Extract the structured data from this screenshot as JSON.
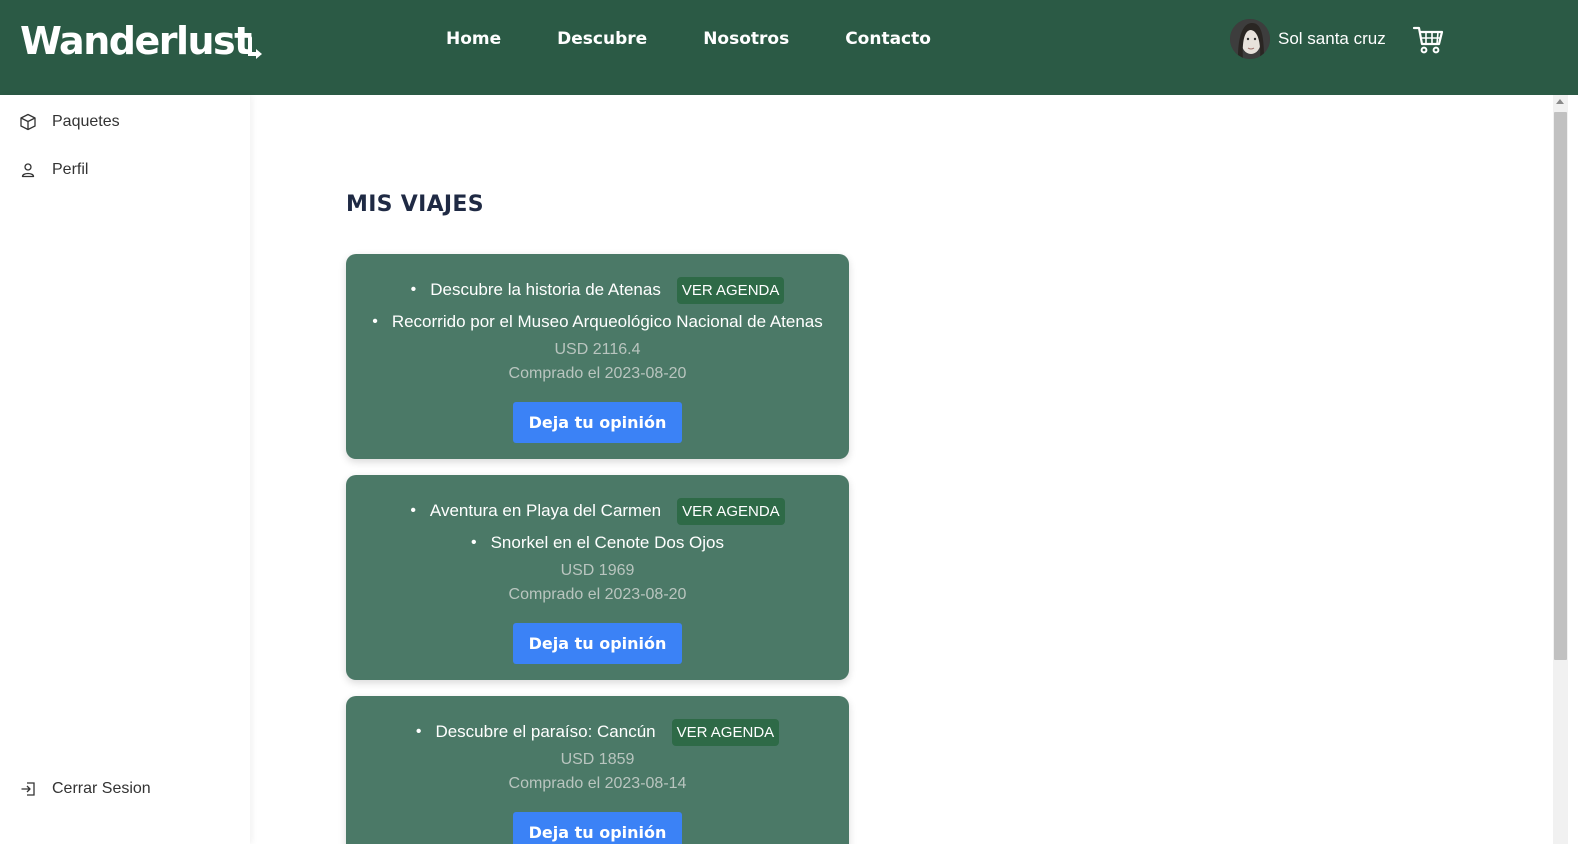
{
  "header": {
    "logo": "Wanderlust",
    "nav": [
      "Home",
      "Descubre",
      "Nosotros",
      "Contacto"
    ],
    "user_name": "Sol santa cruz",
    "avatar_icon": "user-avatar",
    "cart_icon": "shopping-cart-icon"
  },
  "sidebar": {
    "items": [
      {
        "label": "Paquetes",
        "icon": "package-box-icon"
      },
      {
        "label": "Perfil",
        "icon": "user-icon"
      }
    ],
    "logout": {
      "label": "Cerrar Sesion",
      "icon": "logout-icon"
    }
  },
  "main": {
    "title": "MIS VIAJES",
    "trips": [
      {
        "items": [
          "Descubre la historia de Atenas",
          "Recorrido por el Museo Arqueológico Nacional de Atenas"
        ],
        "agenda_label": "VER AGENDA",
        "price": "USD 2116.4",
        "purchased": "Comprado el 2023-08-20",
        "button": "Deja tu opinión"
      },
      {
        "items": [
          "Aventura en Playa del Carmen",
          "Snorkel en el Cenote Dos Ojos"
        ],
        "agenda_label": "VER AGENDA",
        "price": "USD 1969",
        "purchased": "Comprado el 2023-08-20",
        "button": "Deja tu opinión"
      },
      {
        "items": [
          "Descubre el paraíso: Cancún"
        ],
        "agenda_label": "VER AGENDA",
        "price": "USD 1859",
        "purchased": "Comprado el 2023-08-14",
        "button": "Deja tu opinión"
      }
    ]
  },
  "colors": {
    "header": "#2b5a45",
    "card": "#4b7967",
    "agenda_badge": "#2e6a47",
    "button": "#3b82f6"
  }
}
